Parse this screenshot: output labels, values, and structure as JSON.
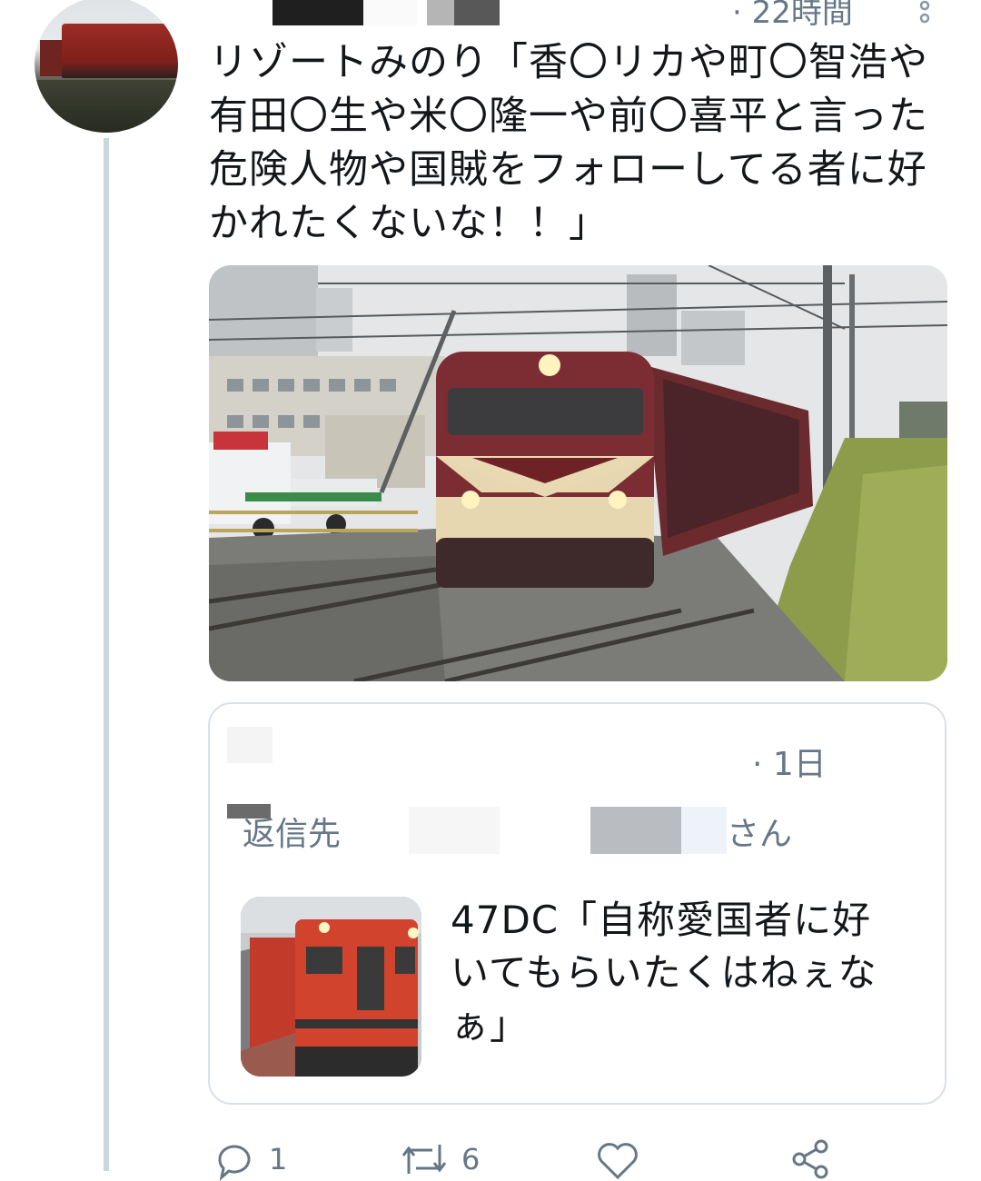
{
  "tweet": {
    "time": "· 22時間",
    "text_lines": [
      "リゾートみのり「香〇リカや町〇智浩や",
      "有田〇生や米〇隆一や前〇喜平と言った",
      "危険人物や国賊をフォローしてる者に好",
      "かれたくないな！！」"
    ]
  },
  "quoted_tweet": {
    "time": "· 1日",
    "reply_prefix": "返信先",
    "reply_suffix": "さん",
    "text_lines": [
      "47DC「自称愛国者に好",
      "いてもらいたくはねぇな",
      "ぁ」"
    ]
  },
  "actions": {
    "reply_count": "1",
    "retweet_count": "6",
    "like_count": "",
    "share_label": ""
  },
  "colors": {
    "secondary_text": "#657786",
    "thread_line": "#cbd5dc",
    "card_border": "#d9e0e6"
  }
}
